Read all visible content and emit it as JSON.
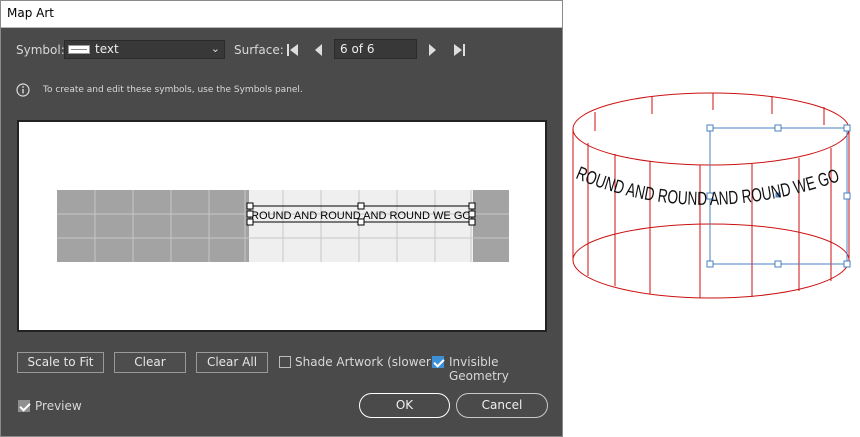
{
  "dialog": {
    "title": "Map Art",
    "symbol_label": "Symbol:",
    "symbol_value": "text",
    "surface_label": "Surface:",
    "surface_page": "6 of 6",
    "info_text": "To create and edit these symbols, use the Symbols panel.",
    "art_text": "ROUND AND ROUND AND ROUND WE GO",
    "buttons": {
      "scale_to_fit": "Scale to Fit",
      "clear": "Clear",
      "clear_all": "Clear All",
      "ok": "OK",
      "cancel": "Cancel"
    },
    "checkboxes": {
      "shade_artwork": {
        "label": "Shade Artwork (slower)",
        "checked": false
      },
      "invisible_geometry": {
        "label": "Invisible Geometry",
        "checked": true
      },
      "preview": {
        "label": "Preview",
        "checked": true
      }
    }
  },
  "artboard": {
    "cylinder_text": "ROUND AND ROUND AND ROUND WE GO",
    "colors": {
      "wireframe": "#cc1111",
      "bounding_box": "#4a7fc1"
    }
  },
  "colors": {
    "dialog_bg": "#4a4a4a",
    "accent": "#3d8fd6"
  },
  "icons": [
    "info-icon",
    "first-page-icon",
    "prev-page-icon",
    "next-page-icon",
    "last-page-icon",
    "chevron-down-icon"
  ]
}
